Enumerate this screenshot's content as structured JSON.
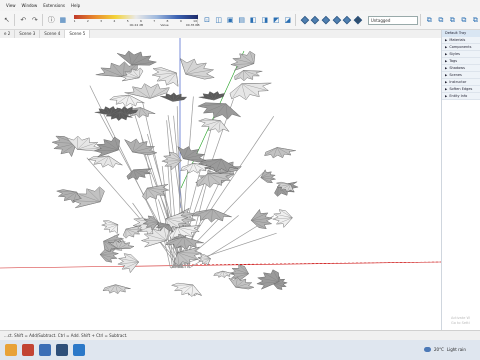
{
  "menu": {
    "items": [
      "View",
      "Window",
      "Extensions",
      "Help"
    ]
  },
  "toolbar": {
    "scale_labels": [
      "1",
      "2",
      "3",
      "4",
      "5",
      "6",
      "7",
      "8",
      "9",
      "10"
    ],
    "scale_min": "00.24 dB",
    "scale_mid": "Value",
    "scale_max": "00.35 RB",
    "tag_select": "Untagged",
    "icons": [
      "select-icon",
      "undo-icon",
      "redo-icon",
      "info-icon",
      "zoom-icon",
      "orbit-icon",
      "pan-icon",
      "styles-icon",
      "shadows-icon",
      "section-icon",
      "xray-icon",
      "back-edges-icon",
      "wireframe-icon",
      "hidden-line-icon",
      "shaded-icon",
      "textured-icon",
      "monochrome-icon",
      "iso-view-icon",
      "top-view-icon",
      "front-view-icon",
      "right-view-icon",
      "back-view-icon",
      "left-view-icon"
    ]
  },
  "scenes": {
    "tabs": [
      "e 2",
      "Scene 3",
      "Scene 4",
      "Scene 5"
    ],
    "active": 3
  },
  "tray": {
    "title": "Default Tray",
    "items": [
      "Materials",
      "Components",
      "Styles",
      "Tags",
      "Shadows",
      "Scenes",
      "Instructor",
      "Soften Edges",
      "Entity Info"
    ]
  },
  "watermark": {
    "line1": "Activate W",
    "line2": "Go to Setti"
  },
  "statusbar": {
    "text": "...ct. Shift = Add/Subtract. Ctrl = Add. Shift + Ctrl = Subtract."
  },
  "taskbar": {
    "weather_temp": "20°C",
    "weather_desc": "Light rain"
  },
  "colors": {
    "axis_red": "#d02020",
    "axis_green": "#20a020",
    "axis_blue": "#2040c0",
    "leaf_fill": "#d8d8d8",
    "leaf_stroke": "#555555",
    "accent": "#2a6fb3"
  }
}
